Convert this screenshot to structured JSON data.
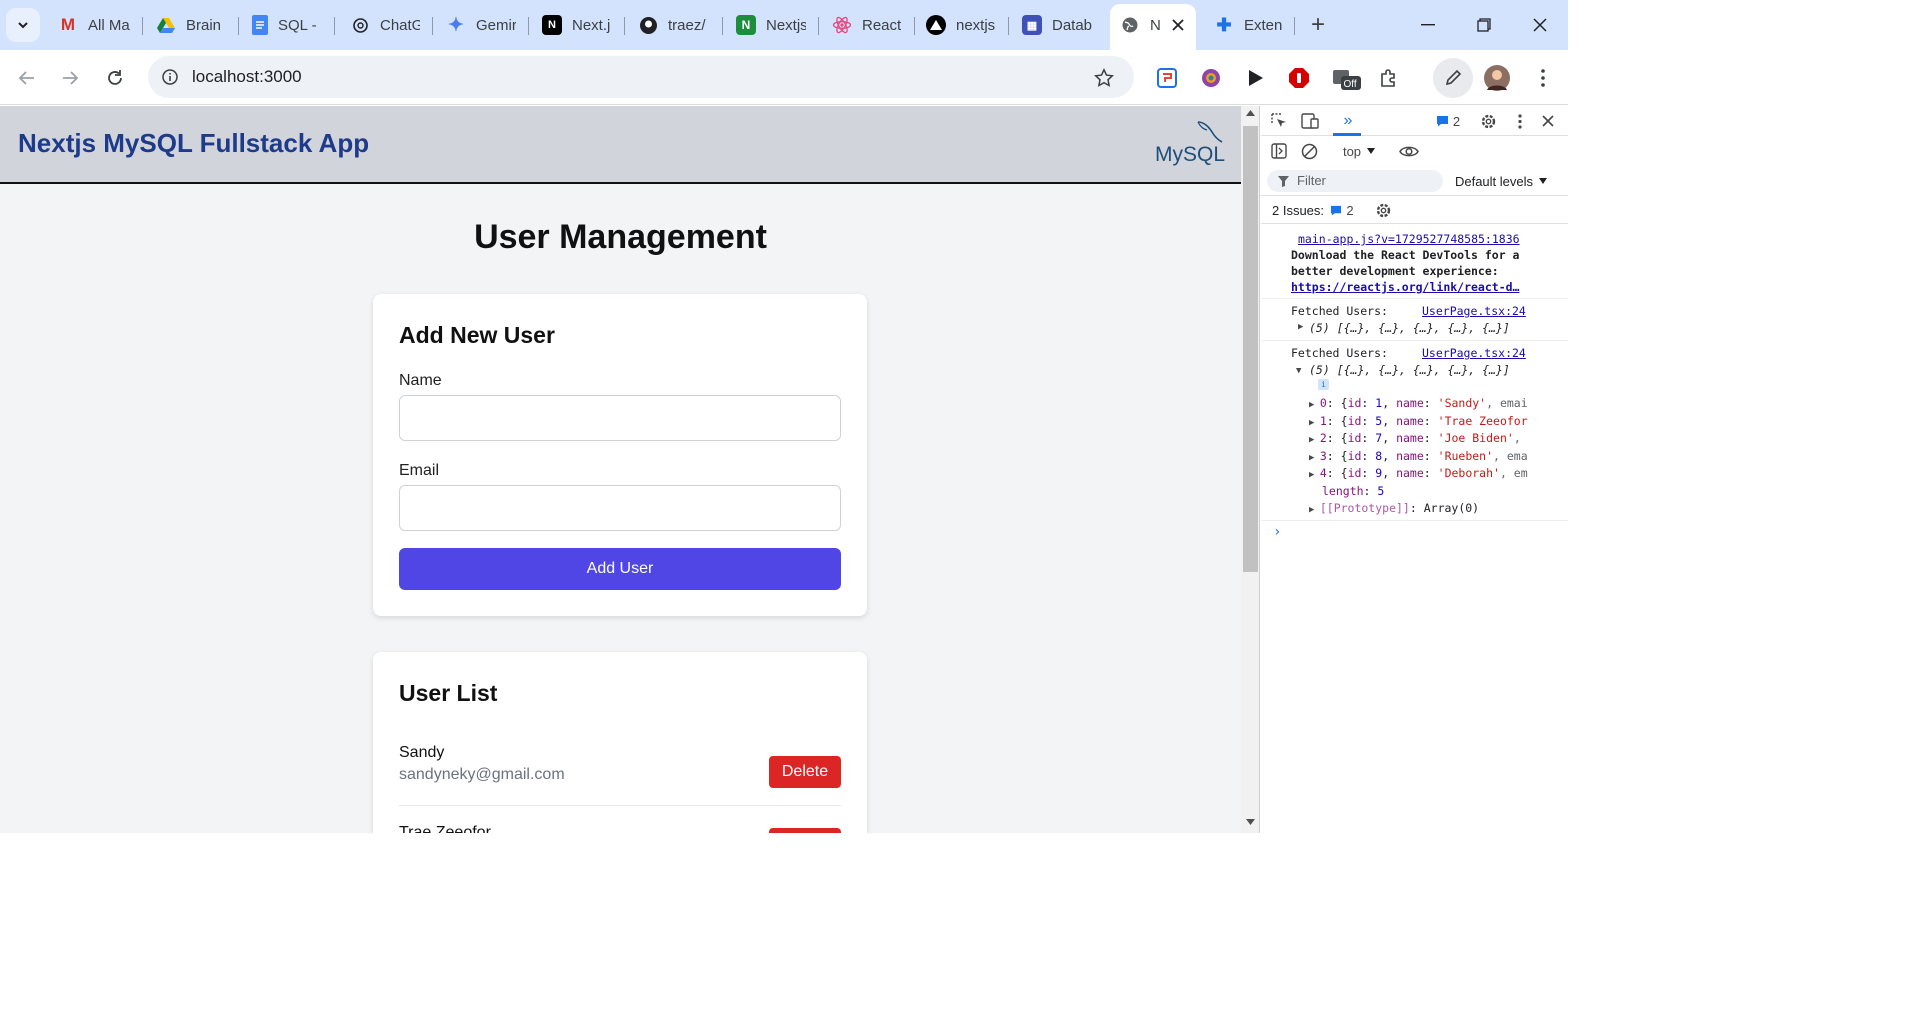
{
  "browser": {
    "tabs": [
      {
        "label": "All Ma",
        "icon": "gmail-icon",
        "color": "#d93025"
      },
      {
        "label": "Brain",
        "icon": "google-drive-icon",
        "color": "#188038"
      },
      {
        "label": "SQL -",
        "icon": "google-docs-icon",
        "color": "#4285f4"
      },
      {
        "label": "ChatG",
        "icon": "chatgpt-icon",
        "color": "#202124"
      },
      {
        "label": "Gemir",
        "icon": "gemini-icon",
        "color": "#4b7bec"
      },
      {
        "label": "Next.j",
        "icon": "nextjs-icon",
        "color": "#000000"
      },
      {
        "label": "traez/",
        "icon": "github-icon",
        "color": "#202124"
      },
      {
        "label": "Nextjs",
        "icon": "nextjs-app-icon",
        "color": "#1e8e3e"
      },
      {
        "label": "React",
        "icon": "react-icon",
        "color": "#e8467c"
      },
      {
        "label": "nextjs",
        "icon": "vercel-icon",
        "color": "#000000"
      },
      {
        "label": "Datab",
        "icon": "database-icon",
        "color": "#3f51b5"
      },
      {
        "label": "N",
        "icon": "globe-icon",
        "color": "#5f6368"
      },
      {
        "label": "Exten",
        "icon": "puzzle-icon",
        "color": "#1a73e8"
      }
    ],
    "url": "localhost:3000"
  },
  "app": {
    "header_title": "Nextjs MySQL Fullstack App",
    "logo_text": "MySQL",
    "page_title": "User Management",
    "form": {
      "heading": "Add New User",
      "name_label": "Name",
      "name_value": "",
      "email_label": "Email",
      "email_value": "",
      "submit_label": "Add User"
    },
    "list": {
      "heading": "User List",
      "users": [
        {
          "name": "Sandy",
          "email": "sandyneky@gmail.com",
          "delete_label": "Delete"
        },
        {
          "name": "Trae Zeeofor",
          "email": "",
          "delete_label": ""
        }
      ]
    }
  },
  "devtools": {
    "issues_badge": "2",
    "context": "top",
    "filter_placeholder": "Filter",
    "levels": "Default levels",
    "issues_label": "2 Issues:",
    "issues_count": "2",
    "console": {
      "source1": "main-app.js?v=1729527748585:1836",
      "msg1_line1": "Download the React DevTools for a",
      "msg1_line2": "better development experience:",
      "msg1_link": "https://reactjs.org/link/react-d…",
      "fetched_label": "Fetched Users:",
      "source2": "UserPage.tsx:24",
      "array_summary": "(5) [{…}, {…}, {…}, {…}, {…}]",
      "source3": "UserPage.tsx:24",
      "items": [
        {
          "idx": "0",
          "id": "1",
          "name": "'Sandy'",
          "rest": ", emai"
        },
        {
          "idx": "1",
          "id": "5",
          "name": "'Trae Zeeofor",
          "rest": ""
        },
        {
          "idx": "2",
          "id": "7",
          "name": "'Joe Biden'",
          "rest": ","
        },
        {
          "idx": "3",
          "id": "8",
          "name": "'Rueben'",
          "rest": ", ema"
        },
        {
          "idx": "4",
          "id": "9",
          "name": "'Deborah'",
          "rest": ", em"
        }
      ],
      "length_key": "length",
      "length_val": "5",
      "proto_key": "[[Prototype]]",
      "proto_val": "Array(0)"
    }
  },
  "colors": {
    "header_title": "#1e3a8a",
    "add_button": "#4f46e5",
    "delete_button": "#dc2626",
    "tabbar": "#d3e3fd"
  }
}
